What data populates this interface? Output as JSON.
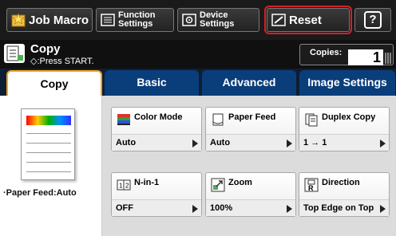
{
  "topbar": {
    "job_macro": "Job Macro",
    "function_settings_line1": "Function",
    "function_settings_line2": "Settings",
    "device_settings_line1": "Device",
    "device_settings_line2": "Settings",
    "reset": "Reset",
    "help": "?"
  },
  "status": {
    "title": "Copy",
    "subtitle": "◇:Press START.",
    "copies_label": "Copies:",
    "copies_value": "1"
  },
  "tabs": [
    "Copy",
    "Basic",
    "Advanced",
    "Image Settings"
  ],
  "preview": {
    "label": "·Paper Feed:Auto"
  },
  "functions": [
    {
      "name": "Color Mode",
      "value": "Auto",
      "icon": "color-mode-icon"
    },
    {
      "name": "Paper Feed",
      "value": "Auto",
      "icon": "paper-feed-icon"
    },
    {
      "name": "Duplex Copy",
      "value": "1 → 1",
      "icon": "duplex-copy-icon"
    },
    {
      "name": "N-in-1",
      "value": "OFF",
      "icon": "n-in-1-icon"
    },
    {
      "name": "Zoom",
      "value": "100%",
      "icon": "zoom-icon"
    },
    {
      "name": "Direction",
      "value": "Top Edge on Top",
      "icon": "direction-icon"
    }
  ],
  "colors": {
    "accent_tab": "#0a3e7a",
    "reset_highlight": "#d81f26",
    "active_tab_border": "#f0a020"
  }
}
